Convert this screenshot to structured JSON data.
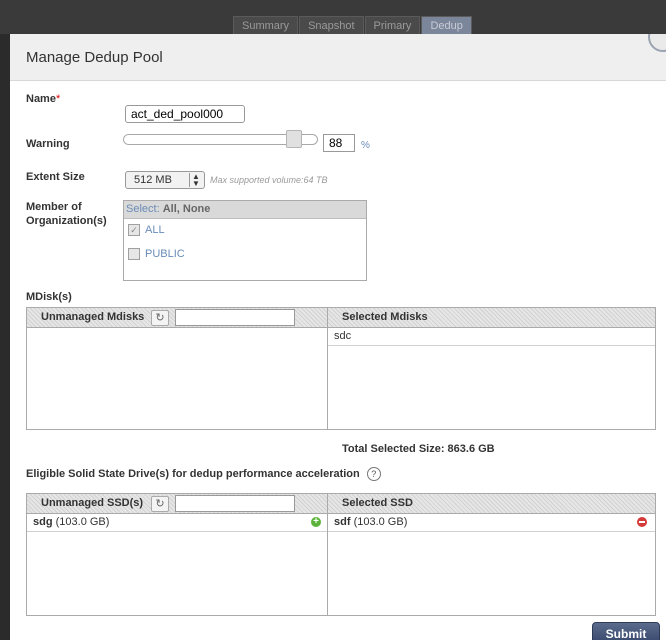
{
  "top_tabs": [
    {
      "label": "Summary",
      "active": false
    },
    {
      "label": "Snapshot",
      "active": false
    },
    {
      "label": "Primary",
      "active": false
    },
    {
      "label": "Dedup",
      "active": true
    }
  ],
  "dialog": {
    "title": "Manage Dedup Pool",
    "submit_label": "Submit"
  },
  "form": {
    "name_label": "Name",
    "name_required_marker": "*",
    "name_value": "act_ded_pool000",
    "warning_label": "Warning",
    "warning_value": "88",
    "warning_unit": "%",
    "warning_slider_fraction": 0.88,
    "extent_label": "Extent Size",
    "extent_value": "512 MB",
    "extent_hint": "Max supported volume:64 TB",
    "member_label_line1": "Member of",
    "member_label_line2": "Organization(s)",
    "select_prefix": "Select:",
    "select_all": "All",
    "select_none": "None",
    "organizations": [
      {
        "label": "ALL",
        "checked": true
      },
      {
        "label": "PUBLIC",
        "checked": false
      }
    ]
  },
  "mdisks": {
    "section_label": "MDisk(s)",
    "unmanaged_header": "Unmanaged Mdisks",
    "selected_header": "Selected Mdisks",
    "unmanaged_filter_value": "",
    "unmanaged_items": [],
    "selected_items": [
      "sdc"
    ],
    "total_label": "Total Selected Size: 863.6 GB"
  },
  "ssd": {
    "section_label": "Eligible Solid State Drive(s) for dedup performance acceleration",
    "help_glyph": "?",
    "unmanaged_header": "Unmanaged SSD(s)",
    "selected_header": "Selected SSD",
    "unmanaged_items": [
      {
        "name": "sdg",
        "size": "(103.0 GB)"
      }
    ],
    "selected_items": [
      {
        "name": "sdf",
        "size": "(103.0 GB)"
      }
    ]
  },
  "icons": {
    "refresh": "refresh-icon",
    "add": "add-icon",
    "remove": "remove-icon",
    "help": "help-icon",
    "close": "close-icon"
  }
}
